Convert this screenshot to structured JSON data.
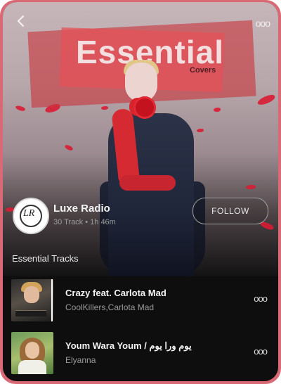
{
  "header": {
    "back_icon": "chevron-left-icon",
    "more_icon": "more-horizontal-icon",
    "more_label": "ooo"
  },
  "hero": {
    "title": "Essential",
    "subtitle": "Covers"
  },
  "artist": {
    "name": "Luxe Radio",
    "meta": "30 Track • 1h 46m",
    "avatar_monogram": "LR",
    "follow_label": "FOLLOW"
  },
  "section": {
    "title": "Essential Tracks"
  },
  "tracks": [
    {
      "title": "Crazy feat. Carlota Mad",
      "artist": "CoolKillers,Carlota Mad",
      "more_label": "ooo"
    },
    {
      "title": "Youm Wara Youm / يوم ورا يوم",
      "artist": "Elyanna",
      "more_label": "ooo"
    }
  ],
  "colors": {
    "frame": "#d96a75",
    "background": "#0e0e0f",
    "banner": "#c8373e"
  }
}
